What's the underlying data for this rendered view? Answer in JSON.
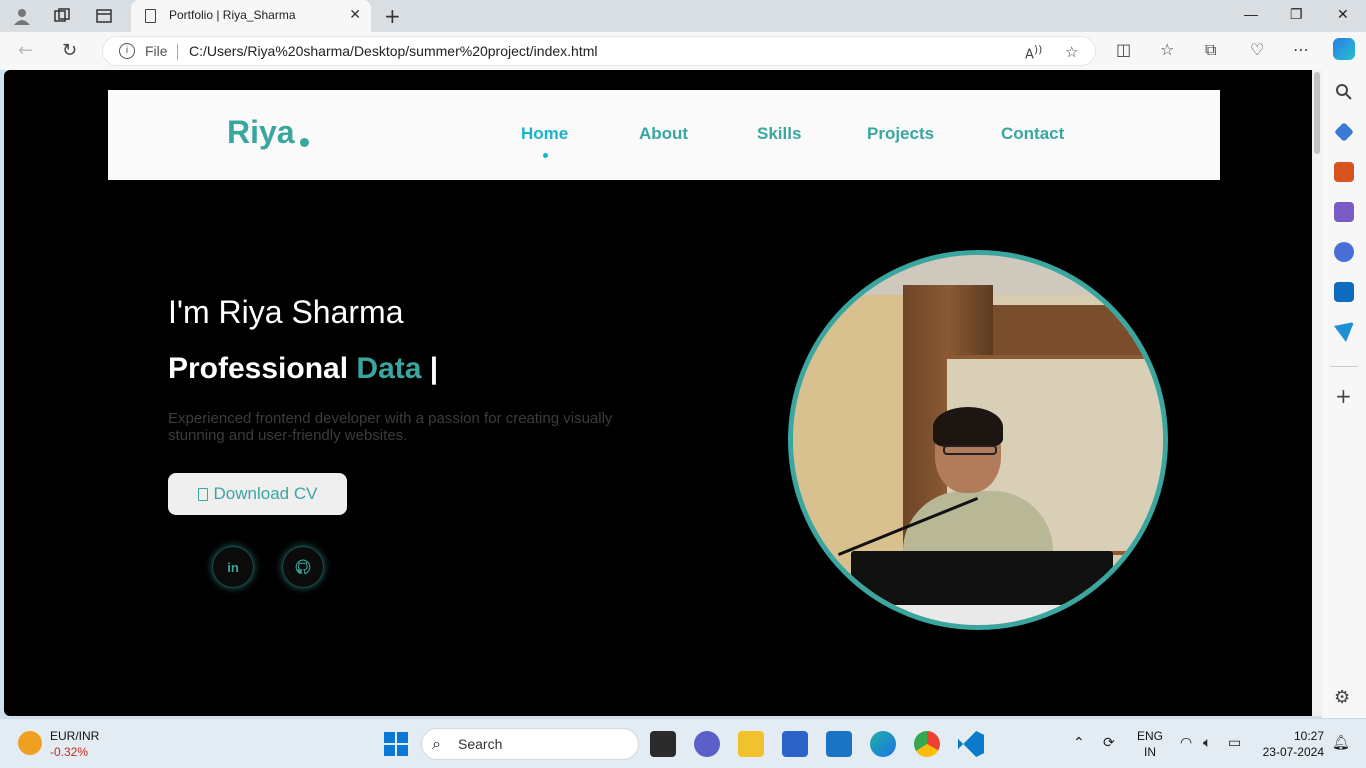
{
  "browser": {
    "tab_title": "Portfolio | Riya_Sharma",
    "site_info_label": "File",
    "url": "C:/Users/Riya%20sharma/Desktop/summer%20project/index.html"
  },
  "site": {
    "logo": "Riya",
    "nav": [
      "Home",
      "About",
      "Skills",
      "Projects",
      "Contact"
    ],
    "active_nav": "Home",
    "greeting": "I'm Riya Sharma",
    "profession_prefix": "Professional",
    "profession_accent": "Data",
    "cursor": "|",
    "description": "Experienced frontend developer with a passion for creating visually stunning and user-friendly websites.",
    "cv_button": "Download CV",
    "social": [
      {
        "name": "linkedin-icon",
        "glyph": "in"
      },
      {
        "name": "github-icon",
        "glyph": "⌥"
      }
    ],
    "accent_color": "#3aa6a0",
    "active_color": "#19b6c9"
  },
  "taskbar": {
    "ticker_label": "EUR/INR",
    "ticker_change": "-0.32%",
    "search_placeholder": "Search",
    "lang": "ENG",
    "region": "IN",
    "time": "10:27",
    "date": "23-07-2024"
  }
}
